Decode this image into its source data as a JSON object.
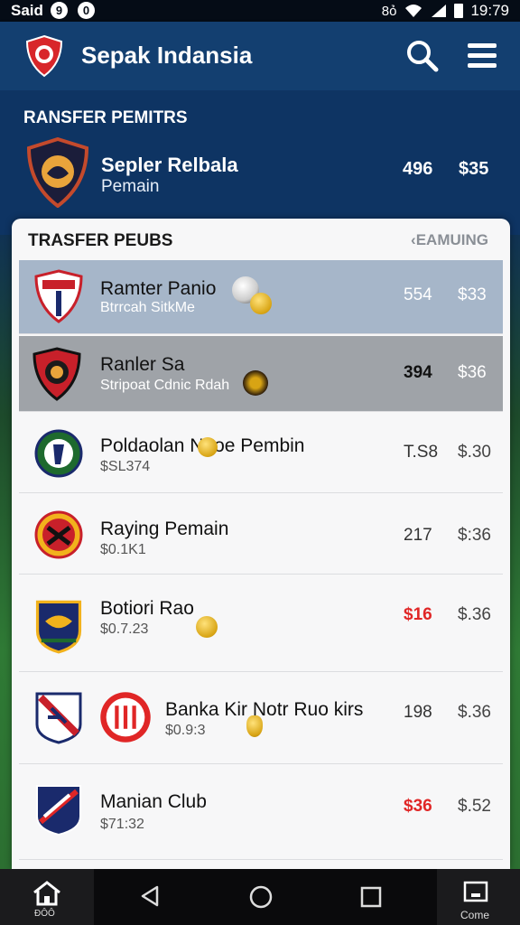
{
  "status_bar": {
    "carrier": "Said",
    "icon1": "9",
    "icon2": "0",
    "signal_text": "8ỏ",
    "time": "19:79"
  },
  "app_bar": {
    "title": "Sepak Indansia",
    "icons": [
      "club-logo-icon",
      "search-icon",
      "menu-icon"
    ]
  },
  "featured": {
    "heading": "RANSFER PEMITRS",
    "name": "Sepler Relbala",
    "subtitle": "Pemain",
    "value1": "496",
    "value2": "$35"
  },
  "list": {
    "title": "TRASFER PEUBS",
    "action": "‹EAMUING",
    "rows": [
      {
        "name": "Ramter Panio",
        "sub": "Btrrcah SitkMe",
        "value1": "554",
        "value2": "$33",
        "value1_red": false
      },
      {
        "name": "Ranler Sa",
        "sub": "Stripoat Cdnic Rdah",
        "value1": "394",
        "value2": "$36",
        "value1_red": false
      },
      {
        "name": "Poldaolan   Naoe Pembin",
        "sub": "$SL374",
        "value1": "T.S8",
        "value2": "$.30",
        "value1_red": false
      },
      {
        "name": "Raying Pemain",
        "sub": "$0.1K1",
        "value1": "217",
        "value2": "$:36",
        "value1_red": false
      },
      {
        "name": "Botiori Rao",
        "sub": "$0.7.23",
        "value1": "$16",
        "value2": "$.36",
        "value1_red": true
      },
      {
        "name": "Banka Kir   Notr Ruo kirs",
        "sub": "$0.9:3",
        "value1": "198",
        "value2": "$.36",
        "value1_red": false
      },
      {
        "name": "Manian Club",
        "sub": "$71:32",
        "value1": "$36",
        "value2": "$.52",
        "value1_red": true
      }
    ]
  },
  "nav_bar": {
    "home_label": "ĐÔÔ",
    "right_label": "Come"
  },
  "colors": {
    "app_bar": "#133f70",
    "highlight_row_1": "#a6b6c9",
    "highlight_row_2": "#9fa3a8",
    "accent_red": "#e02626"
  }
}
